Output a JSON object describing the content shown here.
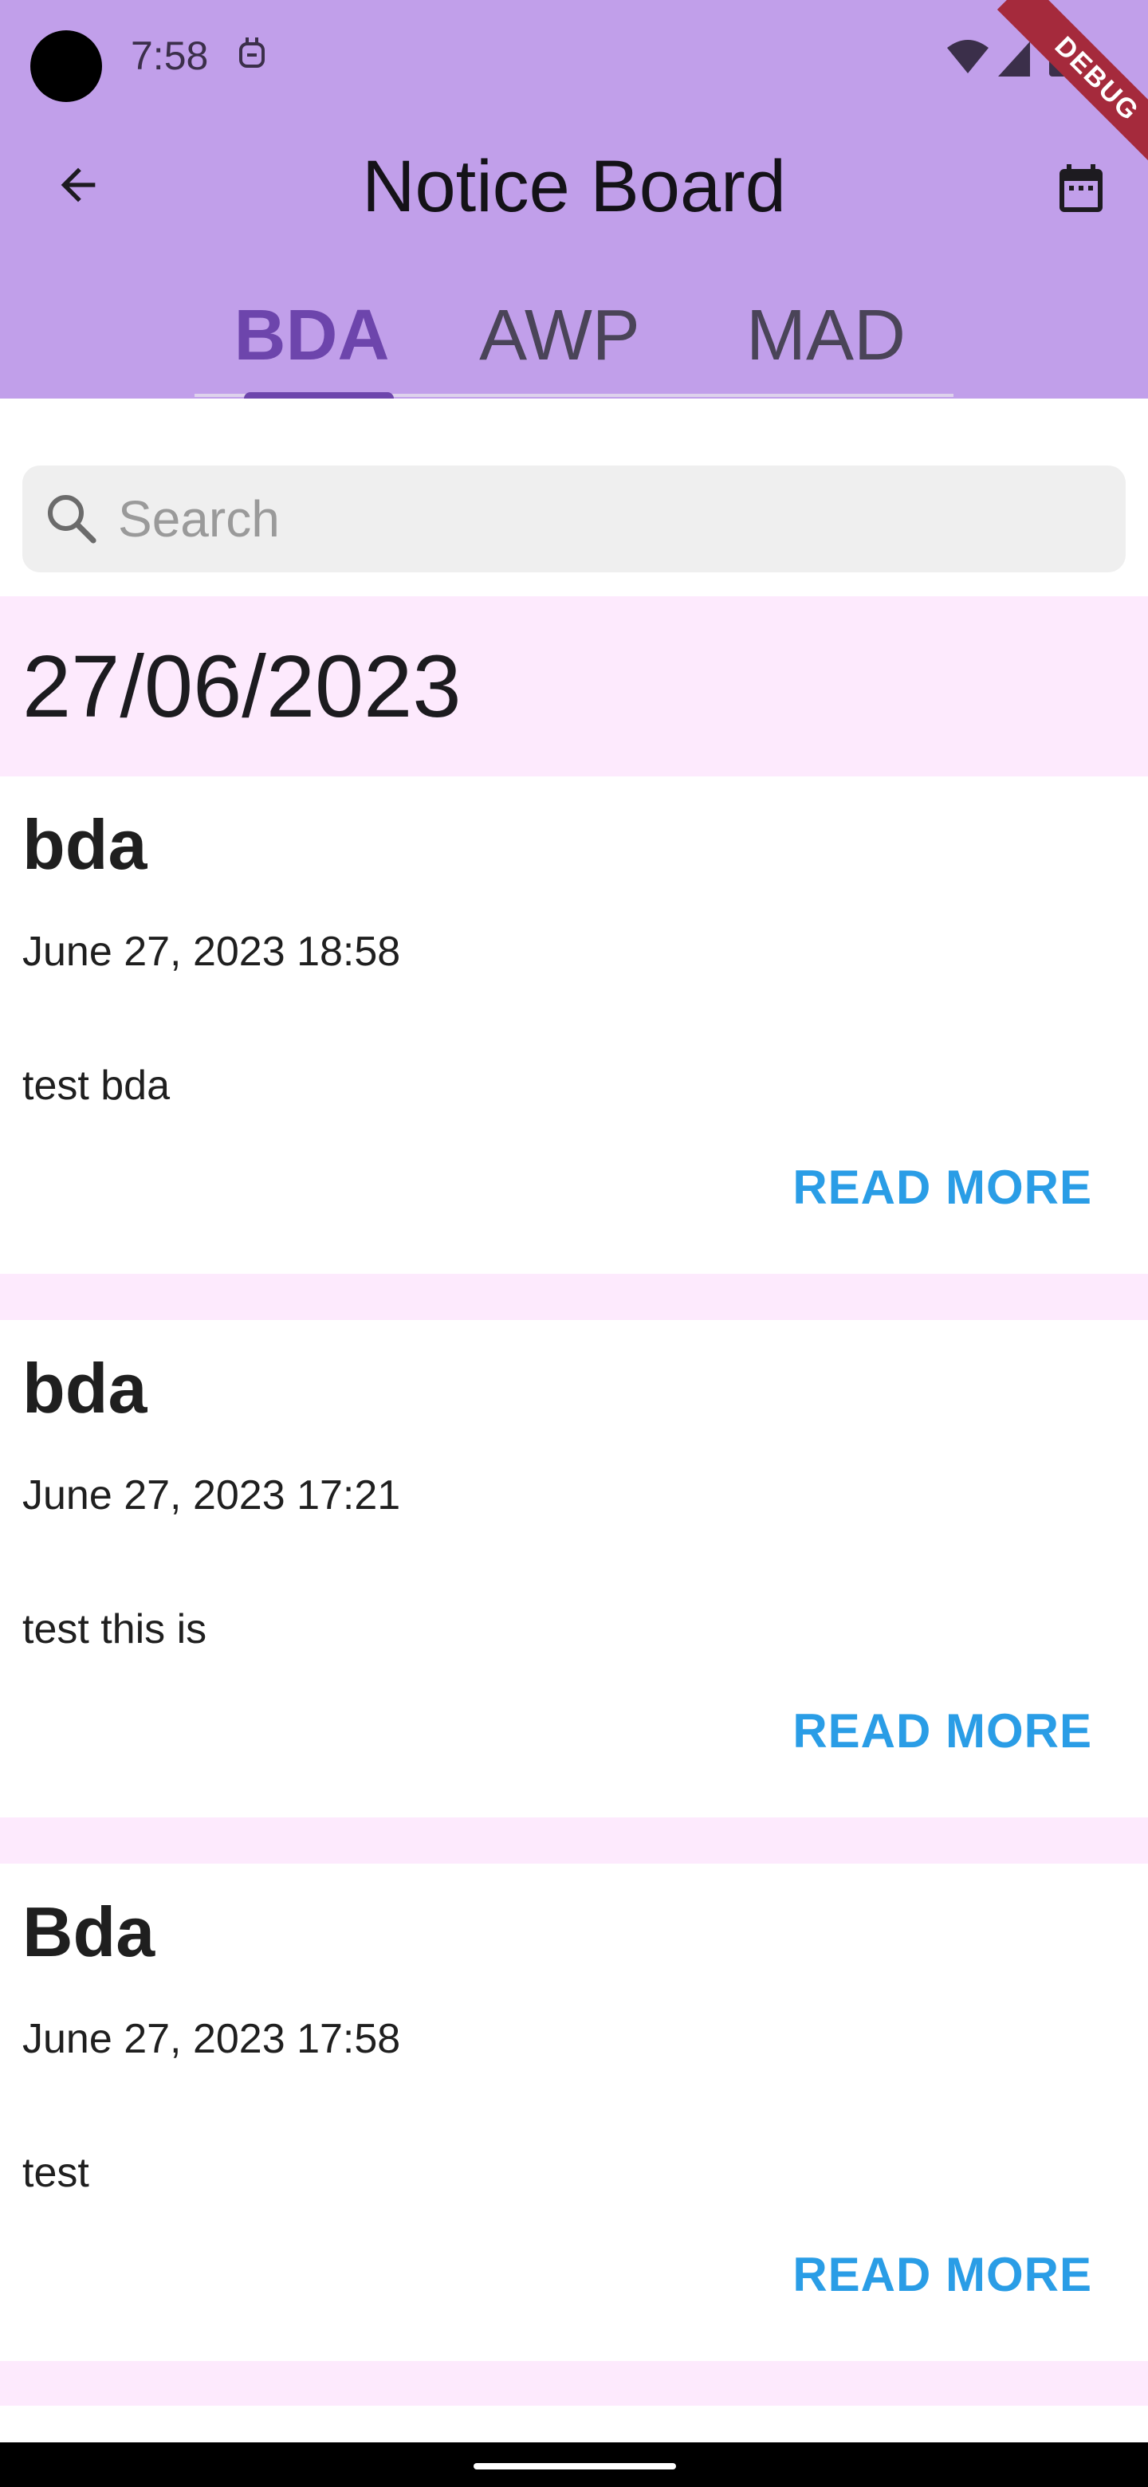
{
  "status_bar": {
    "time": "7:58",
    "icons": [
      "camera-cutout",
      "app-notification-icon",
      "wifi-icon",
      "signal-icon",
      "battery-icon"
    ]
  },
  "debug_banner": "DEBUG",
  "app_bar": {
    "title": "Notice Board",
    "background_color": "#c19fea",
    "back_icon": "arrow-back-icon",
    "action_icon": "calendar-icon"
  },
  "tabs": [
    {
      "label": "BDA",
      "selected": true
    },
    {
      "label": "AWP",
      "selected": false
    },
    {
      "label": "MAD",
      "selected": false
    }
  ],
  "search": {
    "placeholder": "Search",
    "value": ""
  },
  "date_group": "27/06/2023",
  "notices": [
    {
      "title": "bda",
      "timestamp": "June 27, 2023 18:58",
      "body": "test bda",
      "action": "READ MORE"
    },
    {
      "title": "bda",
      "timestamp": "June 27, 2023 17:21",
      "body": "test this is",
      "action": "READ MORE"
    },
    {
      "title": "Bda",
      "timestamp": "June 27, 2023 17:58",
      "body": "test",
      "action": "READ MORE"
    }
  ],
  "colors": {
    "accent": "#6d45ac",
    "link": "#2a9de6",
    "list_background": "#fdeafd",
    "card": "#ffffff"
  }
}
